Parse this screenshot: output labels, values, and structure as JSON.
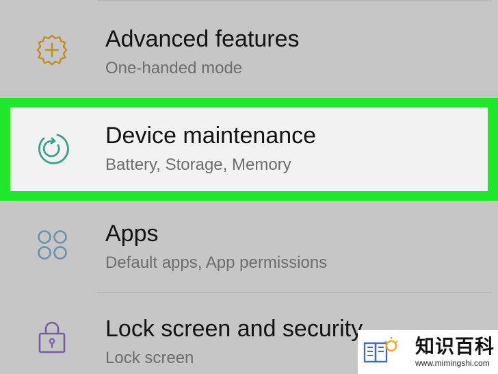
{
  "settings": {
    "items": [
      {
        "title": "Advanced features",
        "subtitle": "One-handed mode",
        "icon": "gear-plus-icon"
      },
      {
        "title": "Device maintenance",
        "subtitle": "Battery, Storage, Memory",
        "icon": "refresh-circle-icon"
      },
      {
        "title": "Apps",
        "subtitle": "Default apps, App permissions",
        "icon": "four-circles-icon"
      },
      {
        "title": "Lock screen and security",
        "subtitle": "Lock screen",
        "icon": "lock-icon"
      }
    ]
  },
  "highlight": {
    "color": "#1de82a"
  },
  "watermark": {
    "name": "知识百科",
    "url": "www.mimingshi.com"
  },
  "colors": {
    "background": "#c6c6c6",
    "highlight_background": "#f2f2f2",
    "title": "#131313",
    "subtitle": "#6d6d6d",
    "advanced_icon": "#c38b2a",
    "maintenance_icon": "#3e9f8a",
    "apps_icon": "#6d8fb0",
    "lock_icon": "#7a5aa6"
  }
}
